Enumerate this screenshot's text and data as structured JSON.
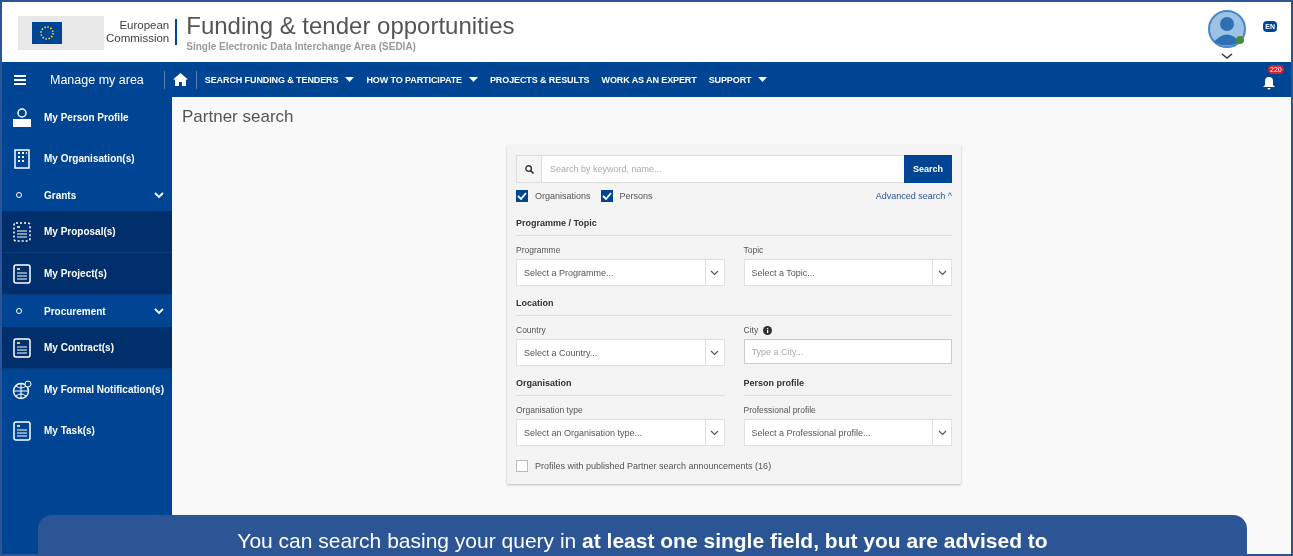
{
  "header": {
    "logo_line_1": "European",
    "logo_line_2": "Commission",
    "title": "Funding & tender opportunities",
    "subtitle": "Single Electronic Data Interchange Area (SEDIA)",
    "language": "EN"
  },
  "navbar": {
    "menu_label": "Manage my area",
    "items": [
      {
        "label": "SEARCH FUNDING & TENDERS",
        "dropdown": true
      },
      {
        "label": "HOW TO PARTICIPATE",
        "dropdown": true
      },
      {
        "label": "PROJECTS & RESULTS",
        "dropdown": false
      },
      {
        "label": "WORK AS AN EXPERT",
        "dropdown": false
      },
      {
        "label": "SUPPORT",
        "dropdown": true
      }
    ],
    "notification_count": "220"
  },
  "sidebar": {
    "items": [
      {
        "kind": "profile",
        "label": "My Person Profile"
      },
      {
        "kind": "building",
        "label": "My Organisation(s)"
      },
      {
        "kind": "group",
        "label": "Grants",
        "expanded": true,
        "children": [
          {
            "kind": "proposal",
            "label": "My Proposal(s)"
          },
          {
            "kind": "document",
            "label": "My Project(s)"
          }
        ]
      },
      {
        "kind": "group",
        "label": "Procurement",
        "expanded": true,
        "children": [
          {
            "kind": "document",
            "label": "My Contract(s)"
          }
        ]
      },
      {
        "kind": "globe",
        "label": "My Formal Notification(s)"
      },
      {
        "kind": "document",
        "label": "My Task(s)"
      }
    ]
  },
  "page_title": "Partner search",
  "search": {
    "placeholder": "Search by keyword, name...",
    "button": "Search",
    "filters": [
      {
        "label": "Organisations",
        "checked": true
      },
      {
        "label": "Persons",
        "checked": true
      }
    ],
    "advanced_link": "Advanced search ^"
  },
  "sections": [
    {
      "title": "Programme / Topic",
      "fields": [
        {
          "kind": "select",
          "label": "Programme",
          "placeholder": "Select a Programme..."
        },
        {
          "kind": "select",
          "label": "Topic",
          "placeholder": "Select a Topic..."
        }
      ]
    },
    {
      "title": "Location",
      "fields": [
        {
          "kind": "select",
          "label": "Country",
          "placeholder": "Select a Country..."
        },
        {
          "kind": "text",
          "label": "City",
          "info": true,
          "placeholder": "Type a City..."
        }
      ]
    }
  ],
  "split_sections": [
    {
      "title": "Organisation",
      "field": {
        "kind": "select",
        "label": "Organisation type",
        "placeholder": "Select an Organisation type..."
      }
    },
    {
      "title": "Person profile",
      "field": {
        "kind": "select",
        "label": "Professional profile",
        "placeholder": "Select a Professional profile..."
      }
    }
  ],
  "announcements_filter": {
    "label": "Profiles with published Partner search announcements (16)",
    "checked": false
  },
  "banner": {
    "text": "You can search basing your query in **at least one single field, but you are advised to**"
  }
}
